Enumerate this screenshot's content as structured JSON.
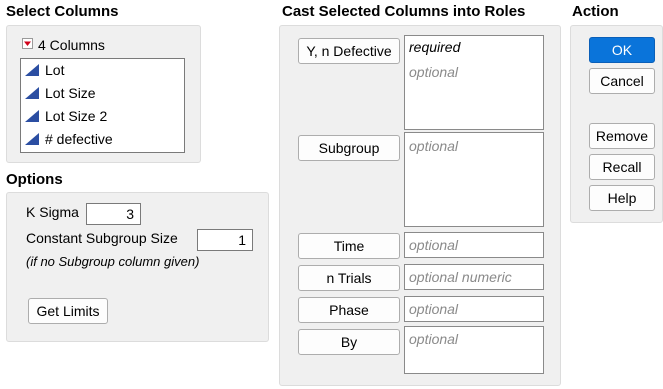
{
  "select_columns": {
    "heading": "Select Columns",
    "count_label": "4 Columns",
    "columns": [
      {
        "label": "Lot",
        "icon": "continuous-column-icon"
      },
      {
        "label": "Lot Size",
        "icon": "continuous-column-icon"
      },
      {
        "label": "Lot Size 2",
        "icon": "continuous-column-icon"
      },
      {
        "label": "# defective",
        "icon": "continuous-column-icon"
      }
    ]
  },
  "options": {
    "heading": "Options",
    "k_sigma_label": "K Sigma",
    "k_sigma_value": "3",
    "constant_subgroup_label": "Constant Subgroup Size",
    "constant_subgroup_value": "1",
    "note": "(if no Subgroup column given)",
    "get_limits_label": "Get Limits"
  },
  "cast": {
    "heading": "Cast Selected Columns into Roles",
    "roles": [
      {
        "button": "Y, n Defective",
        "hint1": "required",
        "hint2": "optional"
      },
      {
        "button": "Subgroup",
        "hint1": "optional"
      },
      {
        "button": "Time",
        "hint1": "optional"
      },
      {
        "button": "n Trials",
        "hint1": "optional numeric"
      },
      {
        "button": "Phase",
        "hint1": "optional"
      },
      {
        "button": "By",
        "hint1": "optional"
      }
    ]
  },
  "action": {
    "heading": "Action",
    "ok": "OK",
    "cancel": "Cancel",
    "remove": "Remove",
    "recall": "Recall",
    "help": "Help"
  },
  "colors": {
    "accent": "#0a74da",
    "column_icon": "#2b4ea2",
    "disclosure": "#d0021b"
  }
}
